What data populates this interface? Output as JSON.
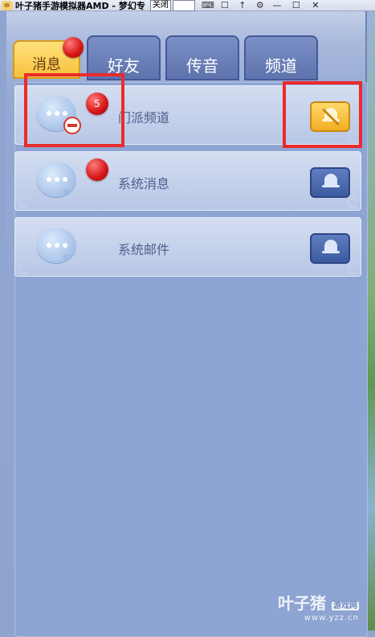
{
  "window": {
    "title": "叶子猪手游模拟器AMD - 梦幻专",
    "close_label": "关闭",
    "icons": [
      "keyboard-icon",
      "chat-icon",
      "pin-icon",
      "gear-icon",
      "minimize-icon",
      "maximize-icon",
      "close-icon"
    ]
  },
  "tabs": [
    {
      "label": "消息",
      "active": true
    },
    {
      "label": "好友",
      "active": false
    },
    {
      "label": "传音",
      "active": false
    },
    {
      "label": "频道",
      "active": false
    }
  ],
  "rows": [
    {
      "label": "门派频道",
      "badge": "5",
      "muted": true,
      "blocked": true
    },
    {
      "label": "系统消息",
      "badge": "",
      "muted": false,
      "blocked": false
    },
    {
      "label": "系统邮件",
      "badge": "",
      "muted": false,
      "blocked": false
    }
  ],
  "watermark": {
    "brand": "叶子猪",
    "tag": "游戏网",
    "url": "www.yzz.cn"
  },
  "colors": {
    "highlight_box": "#ea2b2b",
    "active_tab": "#f6c13c",
    "panel": "#8ea4d2"
  }
}
